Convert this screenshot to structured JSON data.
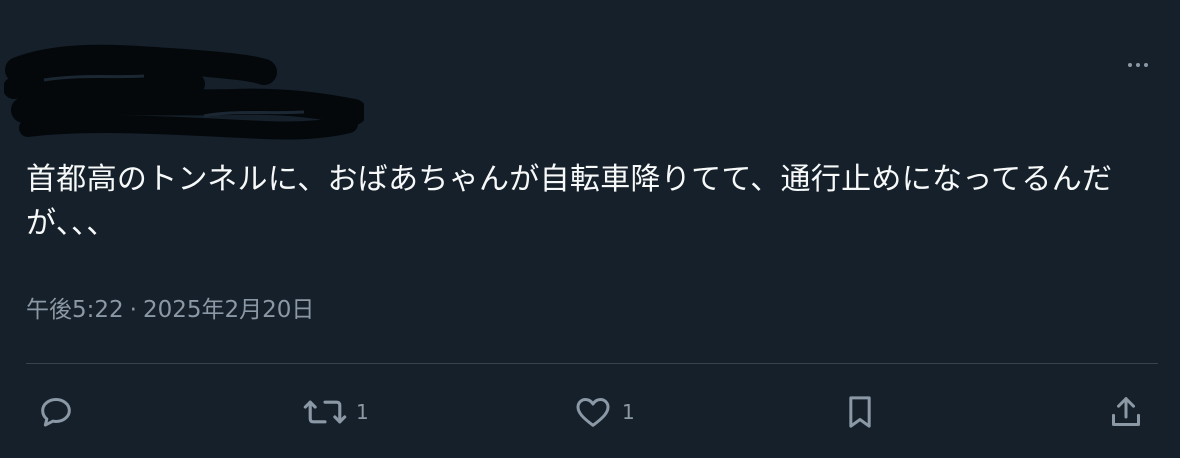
{
  "tweet": {
    "text": "首都高のトンネルに、おばあちゃんが自転車降りてて、通行止めになってるんだが、、、",
    "time": "午後5:22",
    "date": "2025年2月20日",
    "separator": "·"
  },
  "actions": {
    "reply": {
      "icon": "reply-icon"
    },
    "retweet": {
      "icon": "retweet-icon",
      "count": "1"
    },
    "like": {
      "icon": "heart-icon",
      "count": "1"
    },
    "bookmark": {
      "icon": "bookmark-icon"
    },
    "share": {
      "icon": "share-icon"
    }
  },
  "colors": {
    "background": "#15202b",
    "text": "#f7f9f9",
    "secondary": "#8b98a5",
    "divider": "#38444d"
  }
}
